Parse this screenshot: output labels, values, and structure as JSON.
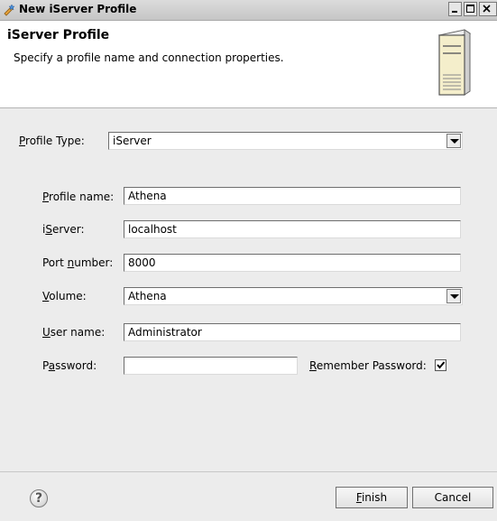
{
  "window": {
    "title": "New iServer Profile"
  },
  "header": {
    "title": "iServer Profile",
    "description": "Specify a profile name and connection properties."
  },
  "form": {
    "profile_type": {
      "label_mn": "P",
      "label_rest": "rofile Type:",
      "value": "iServer"
    },
    "profile_name": {
      "label_mn": "P",
      "label_rest": "rofile name:",
      "value": "Athena"
    },
    "iserver": {
      "label_pre": "i",
      "label_mn": "S",
      "label_rest": "erver:",
      "value": "localhost"
    },
    "port_number": {
      "label_pre": "Port ",
      "label_mn": "n",
      "label_rest": "umber:",
      "value": "8000"
    },
    "volume": {
      "label_mn": "V",
      "label_rest": "olume:",
      "value": "Athena"
    },
    "user_name": {
      "label_mn": "U",
      "label_rest": "ser name:",
      "value": "Administrator"
    },
    "password": {
      "label_pre": "P",
      "label_mn": "a",
      "label_rest": "ssword:",
      "value": ""
    },
    "remember_password": {
      "label_mn": "R",
      "label_rest": "emember Password:",
      "checked": true
    }
  },
  "footer": {
    "help_glyph": "?",
    "finish": {
      "mn": "F",
      "rest": "inish"
    },
    "cancel_label": "Cancel"
  }
}
